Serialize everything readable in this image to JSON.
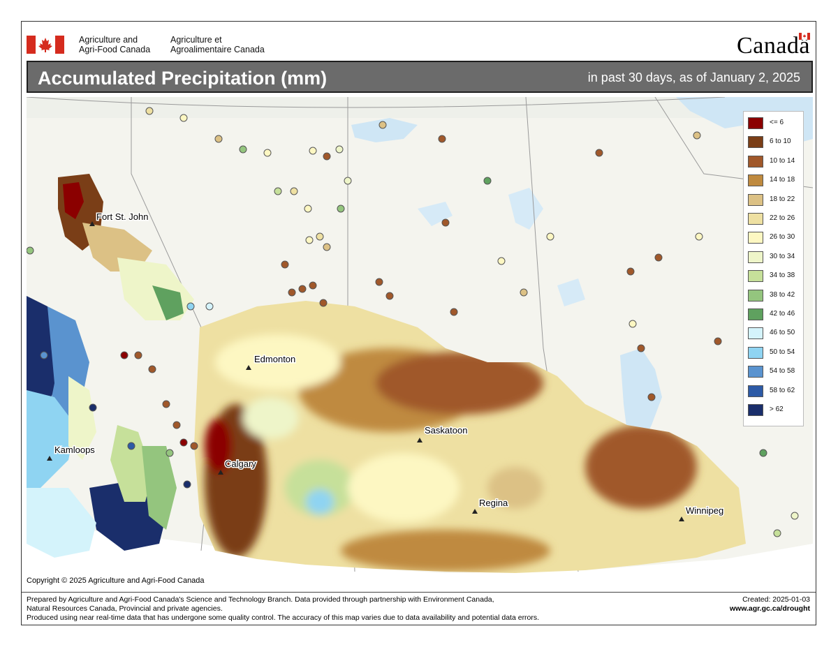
{
  "header": {
    "dept_en_line1": "Agriculture and",
    "dept_en_line2": "Agri-Food Canada",
    "dept_fr_line1": "Agriculture et",
    "dept_fr_line2": "Agroalimentaire Canada",
    "wordmark": "Canadä"
  },
  "title": "Accumulated Precipitation (mm)",
  "subtitle": "in past 30 days, as of January 2, 2025",
  "legend": [
    {
      "label": "<= 6",
      "color": "#8b0000"
    },
    {
      "label": "6 to 10",
      "color": "#7a3e17"
    },
    {
      "label": "10 to 14",
      "color": "#a0582a"
    },
    {
      "label": "14 to 18",
      "color": "#bf8a3f"
    },
    {
      "label": "18 to 22",
      "color": "#dcc185"
    },
    {
      "label": "22 to 26",
      "color": "#eee0a2"
    },
    {
      "label": "26 to 30",
      "color": "#fdf7c2"
    },
    {
      "label": "30 to 34",
      "color": "#eef5c9"
    },
    {
      "label": "34 to 38",
      "color": "#c6e09a"
    },
    {
      "label": "38 to 42",
      "color": "#94c57e"
    },
    {
      "label": "42 to 46",
      "color": "#5fa15f"
    },
    {
      "label": "46 to 50",
      "color": "#d4f3fb"
    },
    {
      "label": "50 to 54",
      "color": "#8fd4f2"
    },
    {
      "label": "54 to 58",
      "color": "#5a93cf"
    },
    {
      "label": "58 to 62",
      "color": "#2d5aa6"
    },
    {
      "label": "> 62",
      "color": "#1a2e6b"
    }
  ],
  "cities": [
    {
      "name": "Fort St. John"
    },
    {
      "name": "Edmonton"
    },
    {
      "name": "Saskatoon"
    },
    {
      "name": "Kamloops"
    },
    {
      "name": "Calgary"
    },
    {
      "name": "Regina"
    },
    {
      "name": "Winnipeg"
    }
  ],
  "copyright": "Copyright © 2025 Agriculture and Agri-Food Canada",
  "footer": {
    "line1": "Prepared by Agriculture and Agri-Food Canada's Science and Technology Branch. Data provided through partnership with Environment Canada,",
    "line2": "Natural Resources Canada, Provincial and private agencies.",
    "line3": "Produced using near real-time data that has undergone some quality control. The accuracy of this map varies due to data availability and potential data errors.",
    "created": "Created: 2025-01-03",
    "website": "www.agr.gc.ca/drought"
  }
}
